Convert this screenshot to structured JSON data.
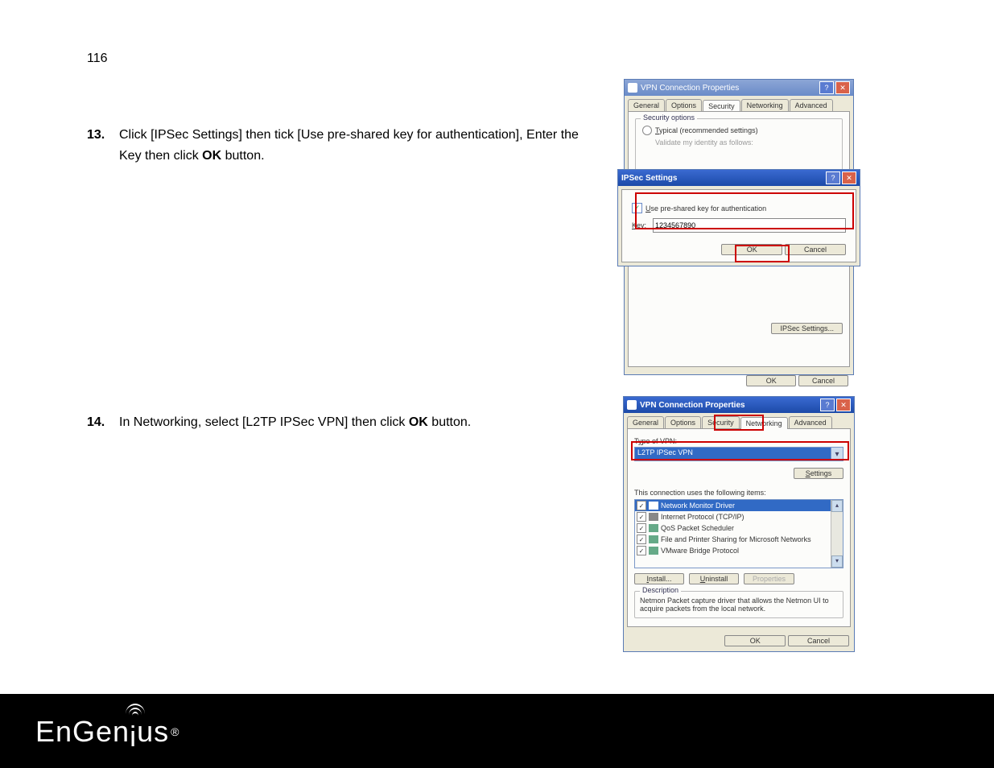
{
  "pageNumber": "116",
  "steps": [
    {
      "num": "13.",
      "text_pre": "Click [IPSec Settings] then tick [Use pre-shared key for authentication], Enter the Key then click ",
      "bold": "OK",
      "text_post": " button."
    },
    {
      "num": "14.",
      "text_pre": "In Networking, select [L2TP IPSec VPN] then click ",
      "bold": "OK",
      "text_post": " button."
    }
  ],
  "shot1": {
    "parent": {
      "title": "VPN Connection Properties",
      "help": "?",
      "close": "✕",
      "tabs": [
        "General",
        "Options",
        "Security",
        "Networking",
        "Advanced"
      ],
      "activeTab": "Security",
      "group": "Security options",
      "radio": "Typical (recommended settings)",
      "disabledLine": "Validate my identity as follows:",
      "ipsecBtn": "IPSec Settings...",
      "ok": "OK",
      "cancel": "Cancel"
    },
    "ipsec": {
      "title": "IPSec Settings",
      "help": "?",
      "close": "✕",
      "chk": "Use pre-shared key for authentication",
      "keylabel": "Key:",
      "keyval": "1234567890",
      "ok": "OK",
      "cancel": "Cancel"
    }
  },
  "shot2": {
    "title": "VPN Connection Properties",
    "help": "?",
    "close": "✕",
    "tabs": [
      "General",
      "Options",
      "Security",
      "Networking",
      "Advanced"
    ],
    "activeTab": "Networking",
    "typeLabel": "Type of VPN:",
    "typeValue": "L2TP IPSec VPN",
    "settingsBtn": "Settings",
    "listLabel": "This connection uses the following items:",
    "items": [
      {
        "label": "Network Monitor Driver",
        "selected": true
      },
      {
        "label": "Internet Protocol (TCP/IP)",
        "selected": false
      },
      {
        "label": "QoS Packet Scheduler",
        "selected": false
      },
      {
        "label": "File and Printer Sharing for Microsoft Networks",
        "selected": false
      },
      {
        "label": "VMware Bridge Protocol",
        "selected": false
      }
    ],
    "install": "Install...",
    "uninstall": "Uninstall",
    "properties": "Properties",
    "descTitle": "Description",
    "descText": "Netmon Packet capture driver that allows the Netmon UI to acquire packets from the local network.",
    "ok": "OK",
    "cancel": "Cancel"
  },
  "brand": {
    "name_start": "EnGen",
    "name_end": "us",
    "reg": "®"
  }
}
